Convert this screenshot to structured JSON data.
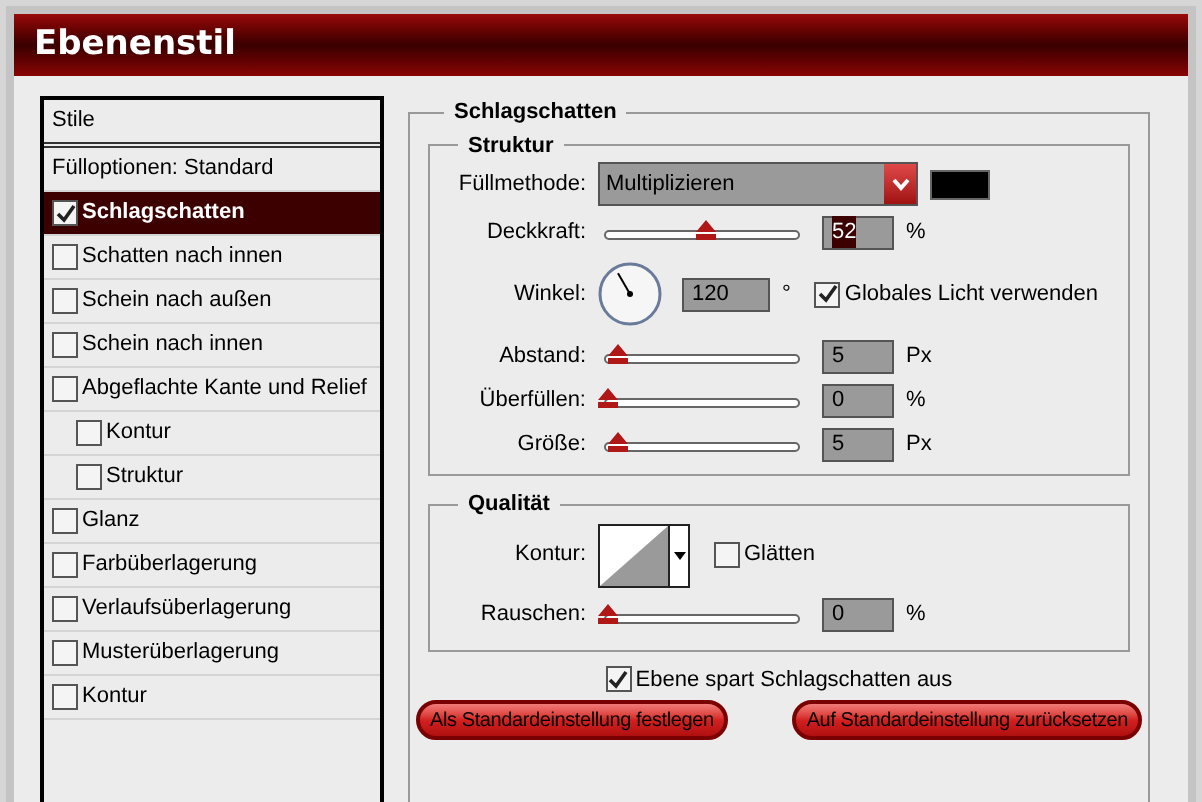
{
  "window": {
    "title": "Ebenenstil"
  },
  "styles": {
    "header": "Stile",
    "items": [
      {
        "kind": "plain",
        "label": "Fülloptionen: Standard",
        "selected": false
      },
      {
        "kind": "check",
        "label": "Schlagschatten",
        "checked": true,
        "selected": true
      },
      {
        "kind": "check",
        "label": "Schatten nach innen",
        "checked": false,
        "selected": false
      },
      {
        "kind": "check",
        "label": "Schein nach außen",
        "checked": false,
        "selected": false
      },
      {
        "kind": "check",
        "label": "Schein nach innen",
        "checked": false,
        "selected": false
      },
      {
        "kind": "check",
        "label": "Abgeflachte Kante und Relief",
        "checked": false,
        "selected": false,
        "children": [
          {
            "kind": "check",
            "label": "Kontur",
            "checked": false,
            "selected": false
          },
          {
            "kind": "check",
            "label": "Struktur",
            "checked": false,
            "selected": false
          }
        ]
      },
      {
        "kind": "check",
        "label": "Glanz",
        "checked": false,
        "selected": false
      },
      {
        "kind": "check",
        "label": "Farbüberlagerung",
        "checked": false,
        "selected": false
      },
      {
        "kind": "check",
        "label": "Verlaufsüberlagerung",
        "checked": false,
        "selected": false
      },
      {
        "kind": "check",
        "label": "Musterüberlagerung",
        "checked": false,
        "selected": false
      },
      {
        "kind": "check",
        "label": "Kontur",
        "checked": false,
        "selected": false
      }
    ]
  },
  "panel": {
    "title": "Schlagschatten",
    "structure": {
      "title": "Struktur",
      "controls": [
        {
          "kind": "blend",
          "label": "Füllmethode:",
          "value": "Multiplizieren"
        },
        {
          "kind": "slider",
          "label": "Deckkraft:",
          "level": 0.52,
          "value": "52",
          "unit": "%",
          "value_selected": true
        },
        {
          "kind": "angle",
          "label": "Winkel:",
          "value": "120",
          "unit": "°",
          "checkbox": {
            "label": "Globales Licht verwenden",
            "checked": true
          }
        },
        {
          "kind": "slider",
          "label": "Abstand:",
          "level": 0.05,
          "value": "5",
          "unit": "Px"
        },
        {
          "kind": "slider",
          "label": "Überfüllen:",
          "level": 0,
          "value": "0",
          "unit": "%"
        },
        {
          "kind": "slider",
          "label": "Größe:",
          "level": 0.05,
          "value": "5",
          "unit": "Px"
        }
      ]
    },
    "quality": {
      "title": "Qualität",
      "controls": [
        {
          "kind": "contour",
          "label": "Kontur:",
          "checkbox": {
            "label": "Glätten",
            "checked": false
          }
        },
        {
          "kind": "slider",
          "label": "Rauschen:",
          "level": 0,
          "value": "0",
          "unit": "%"
        }
      ]
    },
    "knockout": {
      "label": "Ebene spart Schlagschatten aus",
      "checked": true
    },
    "buttons": [
      "Als Standardeinstellung festlegen",
      "Auf Standardeinstellung zurücksetzen"
    ]
  }
}
